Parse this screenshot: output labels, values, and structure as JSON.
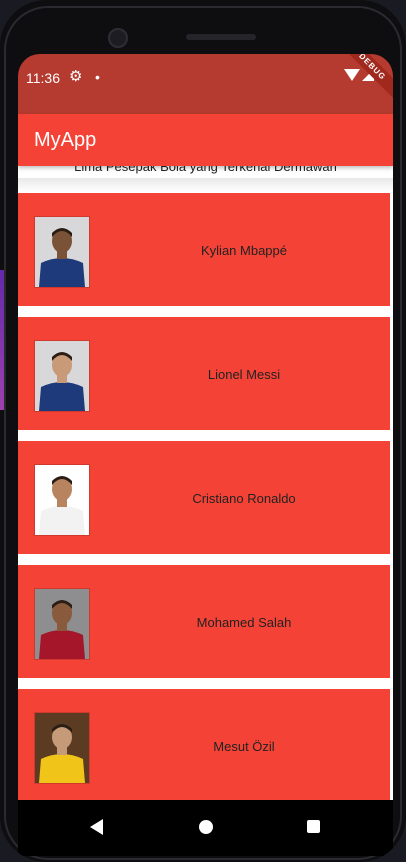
{
  "status_bar": {
    "time": "11:36",
    "icons": [
      "gear-icon",
      "dot-icon",
      "wifi-icon",
      "signal-icon"
    ]
  },
  "debug_banner": "DEBUG",
  "app_bar": {
    "title": "MyApp"
  },
  "list_heading": "Lima Pesepak Bola yang Terkenal Dermawan",
  "players": [
    {
      "name": "Kylian Mbappé",
      "jersey": "#1f3a7a",
      "skin": "#7a5238",
      "bg": "#d8d8da"
    },
    {
      "name": "Lionel Messi",
      "jersey": "#1f3a7a",
      "skin": "#c99a78",
      "bg": "#d8d8da"
    },
    {
      "name": "Cristiano Ronaldo",
      "jersey": "#f2f2f2",
      "skin": "#b8835f",
      "bg": "#ffffff"
    },
    {
      "name": "Mohamed Salah",
      "jersey": "#a5162a",
      "skin": "#8a5a3c",
      "bg": "#8e8e90"
    },
    {
      "name": "Mesut Özil",
      "jersey": "#f0c419",
      "skin": "#c49a78",
      "bg": "#5b3b22"
    }
  ],
  "colors": {
    "accent": "#f44336",
    "status_bar": "#b53a2f"
  }
}
